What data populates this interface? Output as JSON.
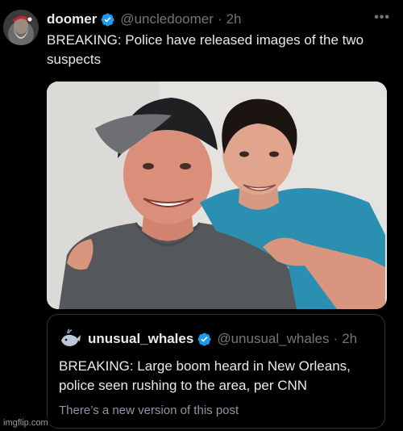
{
  "tweet": {
    "author_name": "doomer",
    "author_handle": "@uncledoomer",
    "separator": "·",
    "time": "2h",
    "more_label": "•••",
    "text": "BREAKING: Police have released images of the two suspects",
    "verified_color": "#1d9bf0"
  },
  "quoted_tweet": {
    "author_name": "unusual_whales",
    "author_handle": "@unusual_whales",
    "separator": "·",
    "time": "2h",
    "text": "BREAKING: Large boom heard in New Orleans, police seen rushing to the area, per CNN",
    "note": "There’s a new version of this post"
  },
  "watermark": "imgflip.com"
}
